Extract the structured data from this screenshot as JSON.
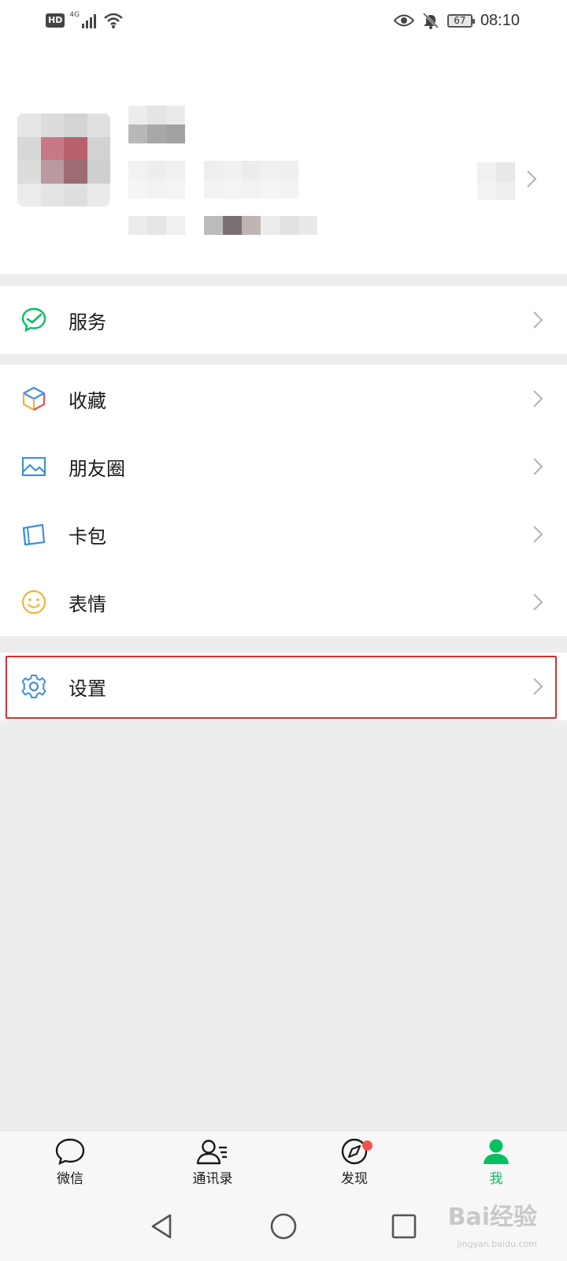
{
  "status_bar": {
    "hd": "HD",
    "network": "4G",
    "battery": "67",
    "time": "08:10"
  },
  "menu": {
    "services": "服务",
    "favorites": "收藏",
    "moments": "朋友圈",
    "cards": "卡包",
    "stickers": "表情",
    "settings": "设置"
  },
  "tabbar": {
    "chats": "微信",
    "contacts": "通讯录",
    "discover": "发现",
    "me": "我"
  },
  "watermark": {
    "brand": "Bai经验",
    "url": "jingyan.baidu.com"
  },
  "colors": {
    "accent_green": "#07c160",
    "badge_red": "#fa5151",
    "highlight_red": "#d9302c"
  }
}
